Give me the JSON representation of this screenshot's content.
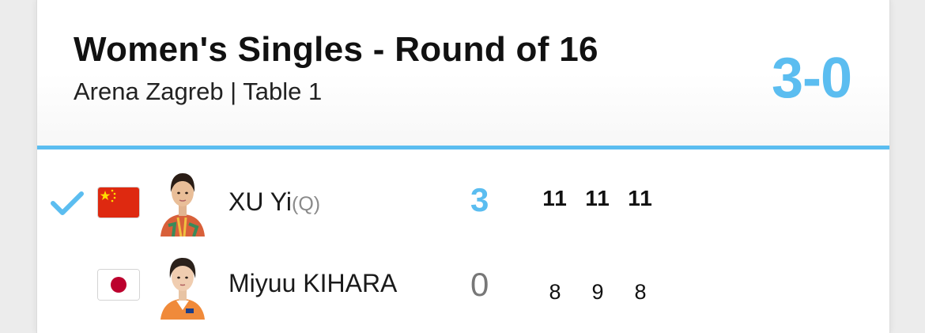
{
  "match": {
    "title": "Women's Singles - Round of 16",
    "venue": "Arena Zagreb | Table 1",
    "score": "3-0"
  },
  "colors": {
    "accent": "#5bbdf0",
    "china_flag": "#de2910",
    "japan_circle": "#bc002d"
  },
  "players": [
    {
      "name": "XU Yi",
      "tag": "(Q)",
      "flag_icon": "china-flag-icon",
      "winner": true,
      "sets": "3",
      "games": [
        "11",
        "11",
        "11"
      ]
    },
    {
      "name": "Miyuu KIHARA",
      "tag": "",
      "flag_icon": "japan-flag-icon",
      "winner": false,
      "sets": "0",
      "games": [
        "8",
        "9",
        "8"
      ]
    }
  ]
}
